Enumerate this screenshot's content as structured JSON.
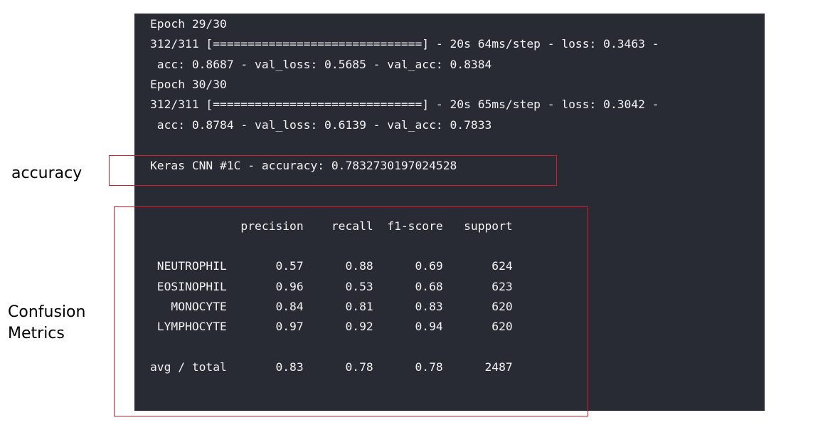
{
  "log": [
    "Epoch 29/30",
    "312/311 [==============================] - 20s 64ms/step - loss: 0.3463 -",
    " acc: 0.8687 - val_loss: 0.5685 - val_acc: 0.8384",
    "Epoch 30/30",
    "312/311 [==============================] - 20s 65ms/step - loss: 0.3042 -",
    " acc: 0.8784 - val_loss: 0.6139 - val_acc: 0.7833"
  ],
  "accuracy_line": "Keras CNN #1C - accuracy: 0.7832730197024528",
  "report": {
    "header": "             precision    recall  f1-score   support",
    "rows": [
      " NEUTROPHIL       0.57      0.88      0.69       624",
      " EOSINOPHIL       0.96      0.53      0.68       623",
      "   MONOCYTE       0.84      0.81      0.83       620",
      " LYMPHOCYTE       0.97      0.92      0.94       620"
    ],
    "total": "avg / total       0.83      0.78      0.78      2487"
  },
  "annotations": {
    "accuracy_label": "accuracy",
    "confusion_label": "Confusion\nMetrics"
  },
  "colors": {
    "terminal_bg": "#282b33",
    "terminal_text": "#f2f2f2",
    "highlight_border": "#d21f26"
  }
}
